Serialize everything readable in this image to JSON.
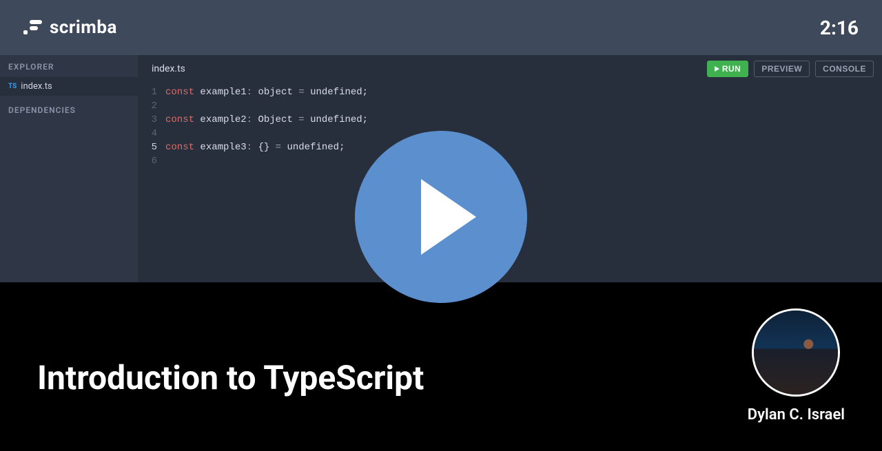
{
  "header": {
    "brand": "scrimba",
    "time": "2:16"
  },
  "sidebar": {
    "explorer_label": "EXPLORER",
    "dependencies_label": "DEPENDENCIES",
    "file_badge": "TS",
    "file_name": "index.ts"
  },
  "editor": {
    "tab_name": "index.ts",
    "buttons": {
      "run": "RUN",
      "preview": "PREVIEW",
      "console": "CONSOLE"
    },
    "active_line": 5,
    "lines": [
      {
        "n": 1,
        "kw": "const",
        "id": "example1",
        "after_id": ":",
        "type": " object ",
        "eq": "=",
        "rest": " undefined;"
      },
      {
        "n": 2,
        "blank": true
      },
      {
        "n": 3,
        "kw": "const",
        "id": "example2",
        "after_id": ":",
        "type": " Object ",
        "eq": "=",
        "rest": " undefined;"
      },
      {
        "n": 4,
        "blank": true
      },
      {
        "n": 5,
        "kw": "const",
        "id": "example3",
        "after_id": ":",
        "type": " {} ",
        "eq": "=",
        "rest": " undefined;"
      },
      {
        "n": 6,
        "blank": true
      }
    ]
  },
  "lesson": {
    "title": "Introduction to TypeScript",
    "instructor": "Dylan C. Israel"
  }
}
